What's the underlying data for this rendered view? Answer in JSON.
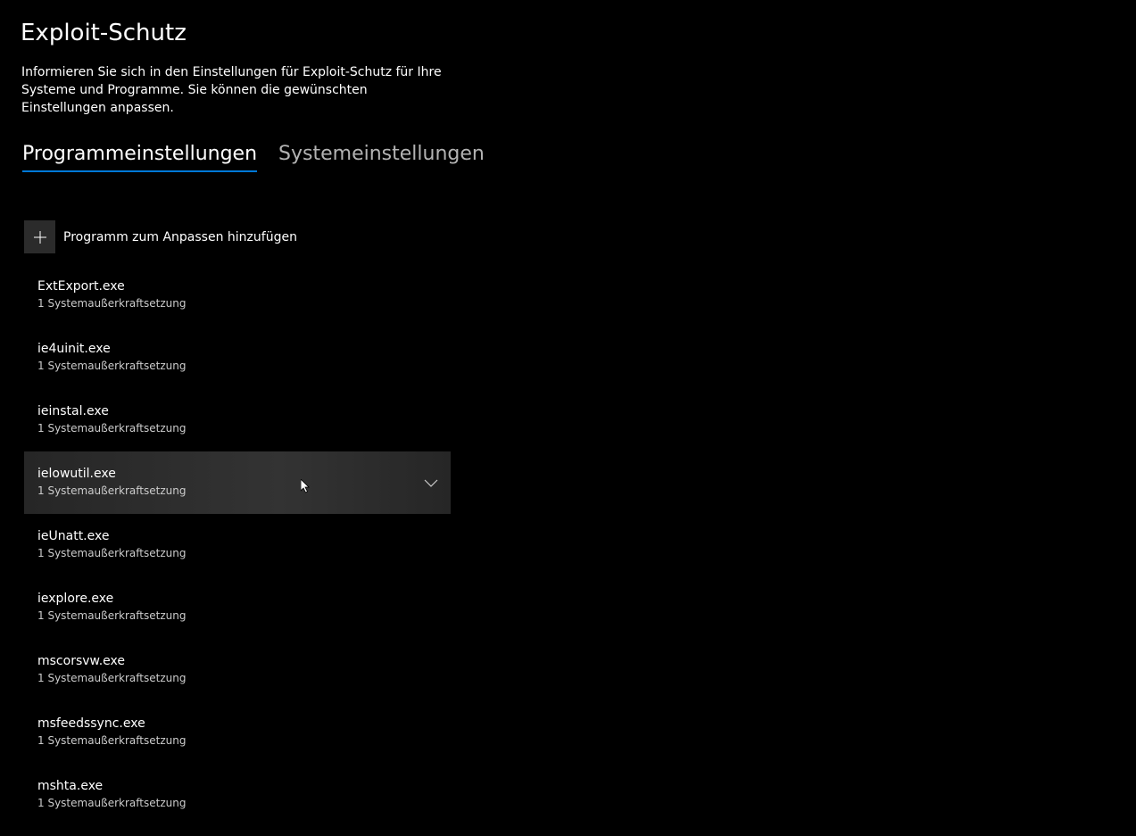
{
  "header": {
    "title": "Exploit-Schutz",
    "description": "Informieren Sie sich in den Einstellungen für Exploit-Schutz für Ihre Systeme und Programme. Sie können die gewünschten Einstellungen anpassen."
  },
  "tabs": [
    {
      "label": "Programmeinstellungen",
      "active": true
    },
    {
      "label": "Systemeinstellungen",
      "active": false
    }
  ],
  "add_button": {
    "icon": "plus-icon",
    "label": "Programm zum Anpassen hinzufügen"
  },
  "programs": [
    {
      "name": "ExtExport.exe",
      "detail": "1 Systemaußerkraftsetzung"
    },
    {
      "name": "ie4uinit.exe",
      "detail": "1 Systemaußerkraftsetzung"
    },
    {
      "name": "ieinstal.exe",
      "detail": "1 Systemaußerkraftsetzung"
    },
    {
      "name": "ielowutil.exe",
      "detail": "1 Systemaußerkraftsetzung",
      "hovered": true
    },
    {
      "name": "ieUnatt.exe",
      "detail": "1 Systemaußerkraftsetzung"
    },
    {
      "name": "iexplore.exe",
      "detail": "1 Systemaußerkraftsetzung"
    },
    {
      "name": "mscorsvw.exe",
      "detail": "1 Systemaußerkraftsetzung"
    },
    {
      "name": "msfeedssync.exe",
      "detail": "1 Systemaußerkraftsetzung"
    },
    {
      "name": "mshta.exe",
      "detail": "1 Systemaußerkraftsetzung"
    }
  ],
  "colors": {
    "background": "#000000",
    "accent": "#0078d7",
    "hover_row": "#333333",
    "button_bg": "#2b2b2b"
  }
}
